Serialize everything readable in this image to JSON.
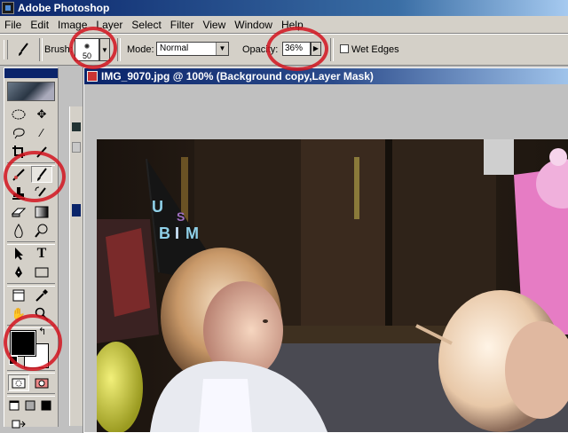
{
  "app": {
    "title": "Adobe Photoshop",
    "icon": "photoshop-icon"
  },
  "menu": [
    "File",
    "Edit",
    "Image",
    "Layer",
    "Select",
    "Filter",
    "View",
    "Window",
    "Help"
  ],
  "options": {
    "tool_icon": "brush-icon",
    "brush_label": "Brush:",
    "brush_size": "50",
    "mode_label": "Mode:",
    "mode_value": "Normal",
    "opacity_label": "Opacity:",
    "opacity_value": "36%",
    "wet_edges_label": "Wet Edges",
    "wet_edges_checked": false
  },
  "toolbox": {
    "foreground_color": "#000000",
    "background_color": "#ffffff",
    "highlighted_tools": [
      "brush-icon",
      "color-swatches"
    ]
  },
  "document": {
    "title": "IMG_9070.jpg @ 100% (Background copy,Layer Mask)"
  },
  "annotations": {
    "color": "#d2141e",
    "count": 4
  }
}
